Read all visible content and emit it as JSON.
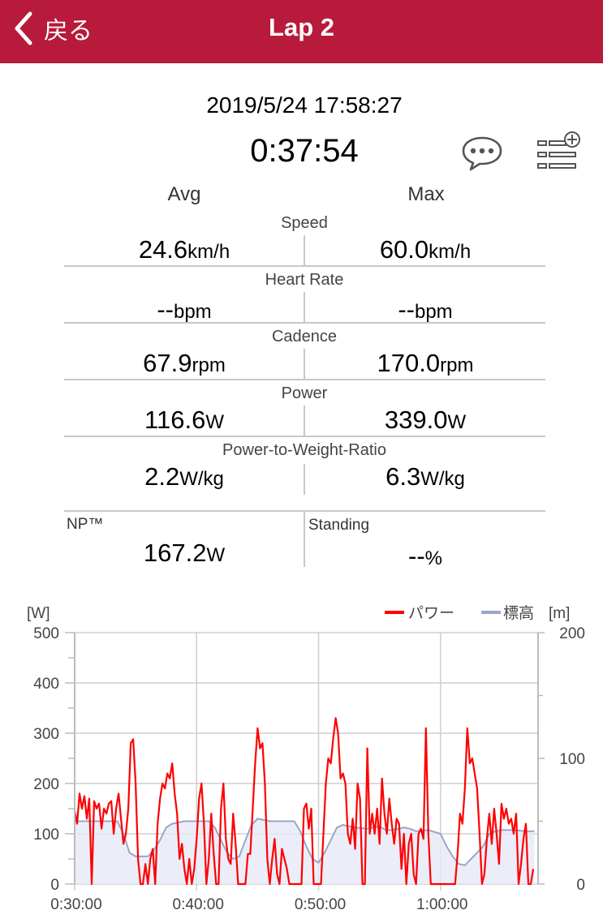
{
  "header": {
    "back_label": "戻る",
    "title": "Lap 2"
  },
  "summary": {
    "datetime": "2019/5/24 17:58:27",
    "duration": "0:37:54"
  },
  "columns": {
    "avg": "Avg",
    "max": "Max"
  },
  "stats": [
    {
      "label": "Speed",
      "avg": "24.6",
      "avg_unit": "km/h",
      "max": "60.0",
      "max_unit": "km/h"
    },
    {
      "label": "Heart Rate",
      "avg": "--",
      "avg_unit": "bpm",
      "max": "--",
      "max_unit": "bpm"
    },
    {
      "label": "Cadence",
      "avg": "67.9",
      "avg_unit": "rpm",
      "max": "170.0",
      "max_unit": "rpm"
    },
    {
      "label": "Power",
      "avg": "116.6",
      "avg_unit": "W",
      "max": "339.0",
      "max_unit": "W"
    },
    {
      "label": "Power-to-Weight-Ratio",
      "avg": "2.2",
      "avg_unit": "W/kg",
      "max": "6.3",
      "max_unit": "W/kg"
    }
  ],
  "extra": {
    "np_label": "NP™",
    "np_value": "167.2",
    "np_unit": "W",
    "standing_label": "Standing",
    "standing_value": "--",
    "standing_unit": "%"
  },
  "icons": {
    "comment": "speech-bubble-icon",
    "add_list": "list-add-icon",
    "back": "chevron-left-icon"
  },
  "colors": {
    "header_bg": "#b71a3b",
    "power_line": "#ff0000",
    "elevation_line": "#9aa6c8",
    "elevation_fill": "#e6eaf7"
  },
  "chart_data": {
    "type": "line",
    "left_unit": "[W]",
    "right_unit": "[m]",
    "y_left_range": [
      0,
      500
    ],
    "y_left_ticks": [
      "0",
      "100",
      "200",
      "300",
      "400",
      "500"
    ],
    "y_right_range": [
      0,
      200
    ],
    "y_right_ticks": [
      "0",
      "100",
      "200"
    ],
    "x_range_min": [
      30,
      68
    ],
    "x_ticks": [
      {
        "min": 30,
        "label": "0:30:00"
      },
      {
        "min": 40,
        "label": "0:40:00"
      },
      {
        "min": 50,
        "label": "0:50:00"
      },
      {
        "min": 60,
        "label": "1:00:00"
      }
    ],
    "legend": [
      {
        "name": "パワー",
        "color": "#ff0000"
      },
      {
        "name": "標高",
        "color": "#9aa6c8"
      }
    ],
    "power_series": {
      "name": "パワー",
      "points": [
        [
          30.0,
          145
        ],
        [
          30.2,
          120
        ],
        [
          30.4,
          180
        ],
        [
          30.6,
          150
        ],
        [
          30.8,
          175
        ],
        [
          31.0,
          130
        ],
        [
          31.2,
          170
        ],
        [
          31.4,
          0
        ],
        [
          31.6,
          165
        ],
        [
          31.8,
          150
        ],
        [
          32.0,
          160
        ],
        [
          32.2,
          110
        ],
        [
          32.4,
          150
        ],
        [
          32.6,
          140
        ],
        [
          32.8,
          160
        ],
        [
          33.0,
          165
        ],
        [
          33.2,
          100
        ],
        [
          33.4,
          150
        ],
        [
          33.6,
          180
        ],
        [
          33.8,
          130
        ],
        [
          34.0,
          80
        ],
        [
          34.2,
          100
        ],
        [
          34.4,
          150
        ],
        [
          34.6,
          280
        ],
        [
          34.8,
          288
        ],
        [
          35.0,
          200
        ],
        [
          35.2,
          50
        ],
        [
          35.4,
          0
        ],
        [
          35.6,
          0
        ],
        [
          35.8,
          40
        ],
        [
          36.0,
          0
        ],
        [
          36.2,
          50
        ],
        [
          36.4,
          70
        ],
        [
          36.6,
          0
        ],
        [
          36.8,
          120
        ],
        [
          37.0,
          170
        ],
        [
          37.2,
          200
        ],
        [
          37.4,
          190
        ],
        [
          37.6,
          220
        ],
        [
          37.8,
          210
        ],
        [
          38.0,
          240
        ],
        [
          38.2,
          180
        ],
        [
          38.4,
          140
        ],
        [
          38.6,
          50
        ],
        [
          38.8,
          80
        ],
        [
          39.0,
          30
        ],
        [
          39.2,
          0
        ],
        [
          39.4,
          50
        ],
        [
          39.6,
          0
        ],
        [
          39.8,
          30
        ],
        [
          40.0,
          90
        ],
        [
          40.2,
          170
        ],
        [
          40.4,
          200
        ],
        [
          40.6,
          120
        ],
        [
          40.8,
          0
        ],
        [
          41.0,
          50
        ],
        [
          41.2,
          140
        ],
        [
          41.4,
          60
        ],
        [
          41.6,
          0
        ],
        [
          41.8,
          0
        ],
        [
          42.0,
          150
        ],
        [
          42.2,
          200
        ],
        [
          42.4,
          90
        ],
        [
          42.6,
          50
        ],
        [
          42.8,
          40
        ],
        [
          43.0,
          140
        ],
        [
          43.2,
          80
        ],
        [
          43.4,
          0
        ],
        [
          43.6,
          0
        ],
        [
          43.8,
          0
        ],
        [
          44.0,
          0
        ],
        [
          44.2,
          60
        ],
        [
          44.4,
          60
        ],
        [
          44.6,
          150
        ],
        [
          44.8,
          240
        ],
        [
          45.0,
          310
        ],
        [
          45.2,
          270
        ],
        [
          45.4,
          280
        ],
        [
          45.6,
          200
        ],
        [
          45.8,
          50
        ],
        [
          46.0,
          0
        ],
        [
          46.2,
          50
        ],
        [
          46.4,
          90
        ],
        [
          46.6,
          20
        ],
        [
          46.8,
          0
        ],
        [
          47.0,
          70
        ],
        [
          47.2,
          50
        ],
        [
          47.4,
          30
        ],
        [
          47.6,
          0
        ],
        [
          47.8,
          0
        ],
        [
          48.0,
          0
        ],
        [
          48.2,
          0
        ],
        [
          48.4,
          0
        ],
        [
          48.6,
          0
        ],
        [
          48.8,
          150
        ],
        [
          49.0,
          160
        ],
        [
          49.2,
          110
        ],
        [
          49.4,
          150
        ],
        [
          49.6,
          0
        ],
        [
          49.8,
          0
        ],
        [
          50.0,
          0
        ],
        [
          50.2,
          0
        ],
        [
          50.4,
          100
        ],
        [
          50.6,
          200
        ],
        [
          50.8,
          250
        ],
        [
          51.0,
          240
        ],
        [
          51.2,
          290
        ],
        [
          51.4,
          330
        ],
        [
          51.6,
          300
        ],
        [
          51.8,
          210
        ],
        [
          52.0,
          220
        ],
        [
          52.2,
          200
        ],
        [
          52.4,
          100
        ],
        [
          52.6,
          80
        ],
        [
          52.8,
          130
        ],
        [
          53.0,
          70
        ],
        [
          53.2,
          200
        ],
        [
          53.4,
          170
        ],
        [
          53.6,
          0
        ],
        [
          53.8,
          0
        ],
        [
          54.0,
          270
        ],
        [
          54.2,
          100
        ],
        [
          54.4,
          140
        ],
        [
          54.6,
          100
        ],
        [
          54.8,
          150
        ],
        [
          55.0,
          80
        ],
        [
          55.2,
          210
        ],
        [
          55.4,
          140
        ],
        [
          55.6,
          100
        ],
        [
          55.8,
          170
        ],
        [
          56.0,
          120
        ],
        [
          56.2,
          80
        ],
        [
          56.4,
          130
        ],
        [
          56.6,
          120
        ],
        [
          56.8,
          30
        ],
        [
          57.0,
          100
        ],
        [
          57.2,
          0
        ],
        [
          57.4,
          80
        ],
        [
          57.6,
          100
        ],
        [
          57.8,
          20
        ],
        [
          58.0,
          0
        ],
        [
          58.2,
          100
        ],
        [
          58.4,
          110
        ],
        [
          58.6,
          90
        ],
        [
          58.8,
          310
        ],
        [
          59.0,
          100
        ],
        [
          59.2,
          0
        ],
        [
          59.4,
          0
        ],
        [
          59.6,
          0
        ],
        [
          59.8,
          0
        ],
        [
          60.0,
          0
        ],
        [
          60.2,
          0
        ],
        [
          60.4,
          0
        ],
        [
          60.6,
          0
        ],
        [
          60.8,
          0
        ],
        [
          61.0,
          0
        ],
        [
          61.2,
          0
        ],
        [
          61.4,
          60
        ],
        [
          61.6,
          140
        ],
        [
          61.8,
          120
        ],
        [
          62.0,
          190
        ],
        [
          62.2,
          310
        ],
        [
          62.4,
          240
        ],
        [
          62.6,
          250
        ],
        [
          62.8,
          220
        ],
        [
          63.0,
          190
        ],
        [
          63.2,
          100
        ],
        [
          63.4,
          0
        ],
        [
          63.6,
          20
        ],
        [
          63.8,
          90
        ],
        [
          64.0,
          140
        ],
        [
          64.2,
          80
        ],
        [
          64.4,
          150
        ],
        [
          64.6,
          100
        ],
        [
          64.8,
          40
        ],
        [
          65.0,
          160
        ],
        [
          65.2,
          130
        ],
        [
          65.4,
          150
        ],
        [
          65.6,
          120
        ],
        [
          65.8,
          130
        ],
        [
          66.0,
          100
        ],
        [
          66.2,
          140
        ],
        [
          66.4,
          0
        ],
        [
          66.6,
          40
        ],
        [
          66.8,
          90
        ],
        [
          67.0,
          120
        ],
        [
          67.2,
          0
        ],
        [
          67.4,
          0
        ],
        [
          67.6,
          30
        ]
      ]
    },
    "elevation_series": {
      "name": "標高",
      "points": [
        [
          30.0,
          50
        ],
        [
          32.0,
          50
        ],
        [
          33.5,
          50
        ],
        [
          34.0,
          40
        ],
        [
          34.5,
          25
        ],
        [
          35.0,
          22
        ],
        [
          35.5,
          22
        ],
        [
          36.0,
          22
        ],
        [
          36.5,
          27
        ],
        [
          37.0,
          35
        ],
        [
          37.5,
          45
        ],
        [
          38.0,
          48
        ],
        [
          39.0,
          50
        ],
        [
          41.0,
          50
        ],
        [
          41.5,
          45
        ],
        [
          42.0,
          35
        ],
        [
          42.5,
          25
        ],
        [
          43.0,
          20
        ],
        [
          43.5,
          22
        ],
        [
          44.0,
          35
        ],
        [
          44.5,
          47
        ],
        [
          45.0,
          52
        ],
        [
          46.0,
          50
        ],
        [
          48.0,
          50
        ],
        [
          48.5,
          42
        ],
        [
          49.0,
          30
        ],
        [
          49.5,
          20
        ],
        [
          50.0,
          17
        ],
        [
          50.5,
          25
        ],
        [
          51.0,
          35
        ],
        [
          51.5,
          45
        ],
        [
          52.0,
          47
        ],
        [
          53.0,
          45
        ],
        [
          54.0,
          44
        ],
        [
          55.0,
          46
        ],
        [
          55.5,
          43
        ],
        [
          56.0,
          43
        ],
        [
          57.0,
          45
        ],
        [
          57.5,
          44
        ],
        [
          58.0,
          42
        ],
        [
          59.0,
          43
        ],
        [
          60.0,
          40
        ],
        [
          60.5,
          30
        ],
        [
          61.0,
          22
        ],
        [
          61.5,
          16
        ],
        [
          62.0,
          15
        ],
        [
          62.5,
          20
        ],
        [
          63.0,
          25
        ],
        [
          63.5,
          30
        ],
        [
          64.0,
          40
        ],
        [
          64.5,
          42
        ],
        [
          65.0,
          43
        ],
        [
          66.0,
          43
        ],
        [
          67.0,
          42
        ],
        [
          67.7,
          42
        ]
      ]
    }
  }
}
